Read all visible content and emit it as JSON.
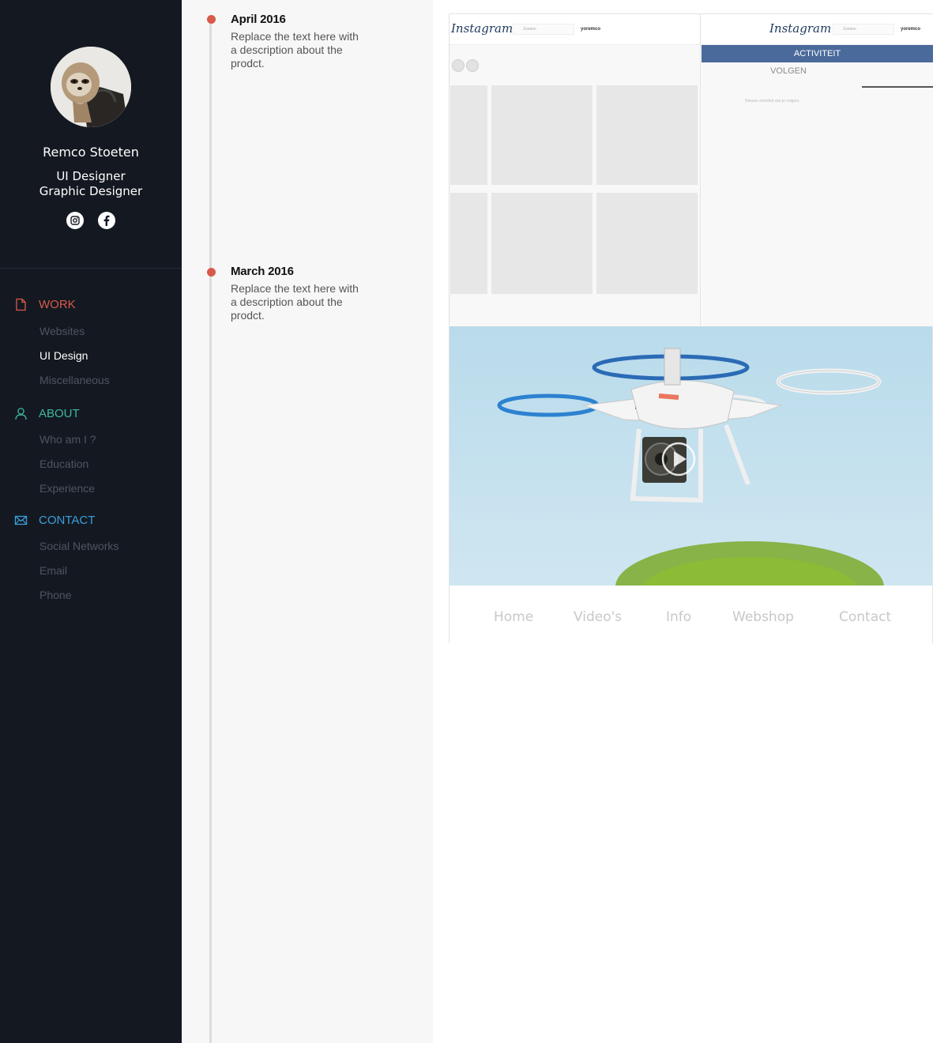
{
  "profile": {
    "name": "Remco Stoeten",
    "roles": [
      "UI Designer",
      "Graphic Designer"
    ],
    "social": [
      "instagram-icon",
      "facebook-icon"
    ]
  },
  "nav": {
    "sections": [
      {
        "label": "WORK",
        "icon": "document-icon",
        "color": "#d9594a",
        "items": [
          "Websites",
          "UI Design",
          "Miscellaneous"
        ],
        "active_item": "UI Design"
      },
      {
        "label": "ABOUT",
        "icon": "user-icon",
        "color": "#3fb8a0",
        "items": [
          "Who am I ?",
          "Education",
          "Experience"
        ]
      },
      {
        "label": "CONTACT",
        "icon": "envelope-icon",
        "color": "#3a9fdd",
        "items": [
          "Social Networks",
          "Email",
          "Phone"
        ]
      }
    ]
  },
  "timeline": [
    {
      "date": "April 2016",
      "description": "Replace the text here with a description about the prodct."
    },
    {
      "date": "March 2016",
      "description": "Replace the text here with a description about the prodct."
    }
  ],
  "mockups": {
    "instagram_left": {
      "logo": "Instagram",
      "search_placeholder": "Zoeken",
      "username": "yoremco"
    },
    "instagram_right": {
      "logo": "Instagram",
      "search_placeholder": "Zoeken",
      "username": "yoremco",
      "active_tab": "ACTIVITEIT",
      "tab": "VOLGEN",
      "notice": "Nieuwe activiteit van je volgers"
    },
    "drone_site_nav": [
      "Home",
      "Video's",
      "Info",
      "Webshop",
      "Contact"
    ]
  },
  "colors": {
    "sidebar_bg": "#141921",
    "accent_work": "#d9594a",
    "accent_about": "#3fb8a0",
    "accent_contact": "#3a9fdd",
    "ig_blue": "#4a6a9b"
  }
}
